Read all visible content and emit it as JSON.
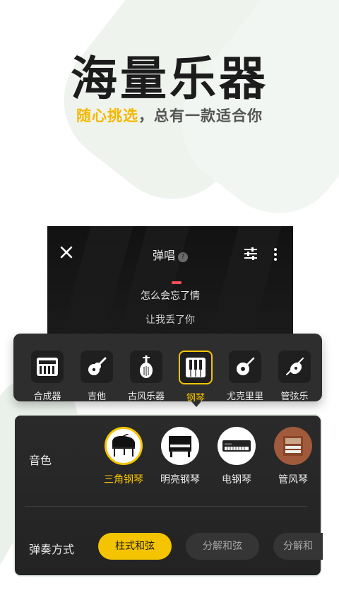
{
  "hero": {
    "title": "海量乐器",
    "subtitle_highlight": "随心挑选",
    "subtitle_rest": "，总有一款适合你"
  },
  "screen": {
    "title": "弹唱",
    "help": "?",
    "lyrics": [
      "怎么会忘了情",
      "让我丢了你"
    ],
    "icons": {
      "close": "close-icon",
      "settings": "sliders-icon",
      "more": "more-icon"
    }
  },
  "instruments": [
    {
      "label": "合成器",
      "icon": "synth-icon"
    },
    {
      "label": "吉他",
      "icon": "guitar-icon"
    },
    {
      "label": "古风乐器",
      "icon": "pipa-icon"
    },
    {
      "label": "钢琴",
      "icon": "piano-keys-icon",
      "active": true
    },
    {
      "label": "尤克里里",
      "icon": "ukulele-icon"
    },
    {
      "label": "管弦乐",
      "icon": "orchestra-icon"
    }
  ],
  "panel": {
    "tone_label": "音色",
    "tones": [
      {
        "label": "三角钢琴",
        "active": true
      },
      {
        "label": "明亮钢琴"
      },
      {
        "label": "电钢琴"
      },
      {
        "label": "管风琴"
      }
    ],
    "play_label": "弹奏方式",
    "styles": [
      {
        "label": "柱式和弦",
        "active": true
      },
      {
        "label": "分解和弦"
      },
      {
        "label": "分解和"
      }
    ]
  },
  "colors": {
    "accent": "#f5c400",
    "dark_panel": "#2e2e2e",
    "text_light": "#e8e8e8"
  }
}
